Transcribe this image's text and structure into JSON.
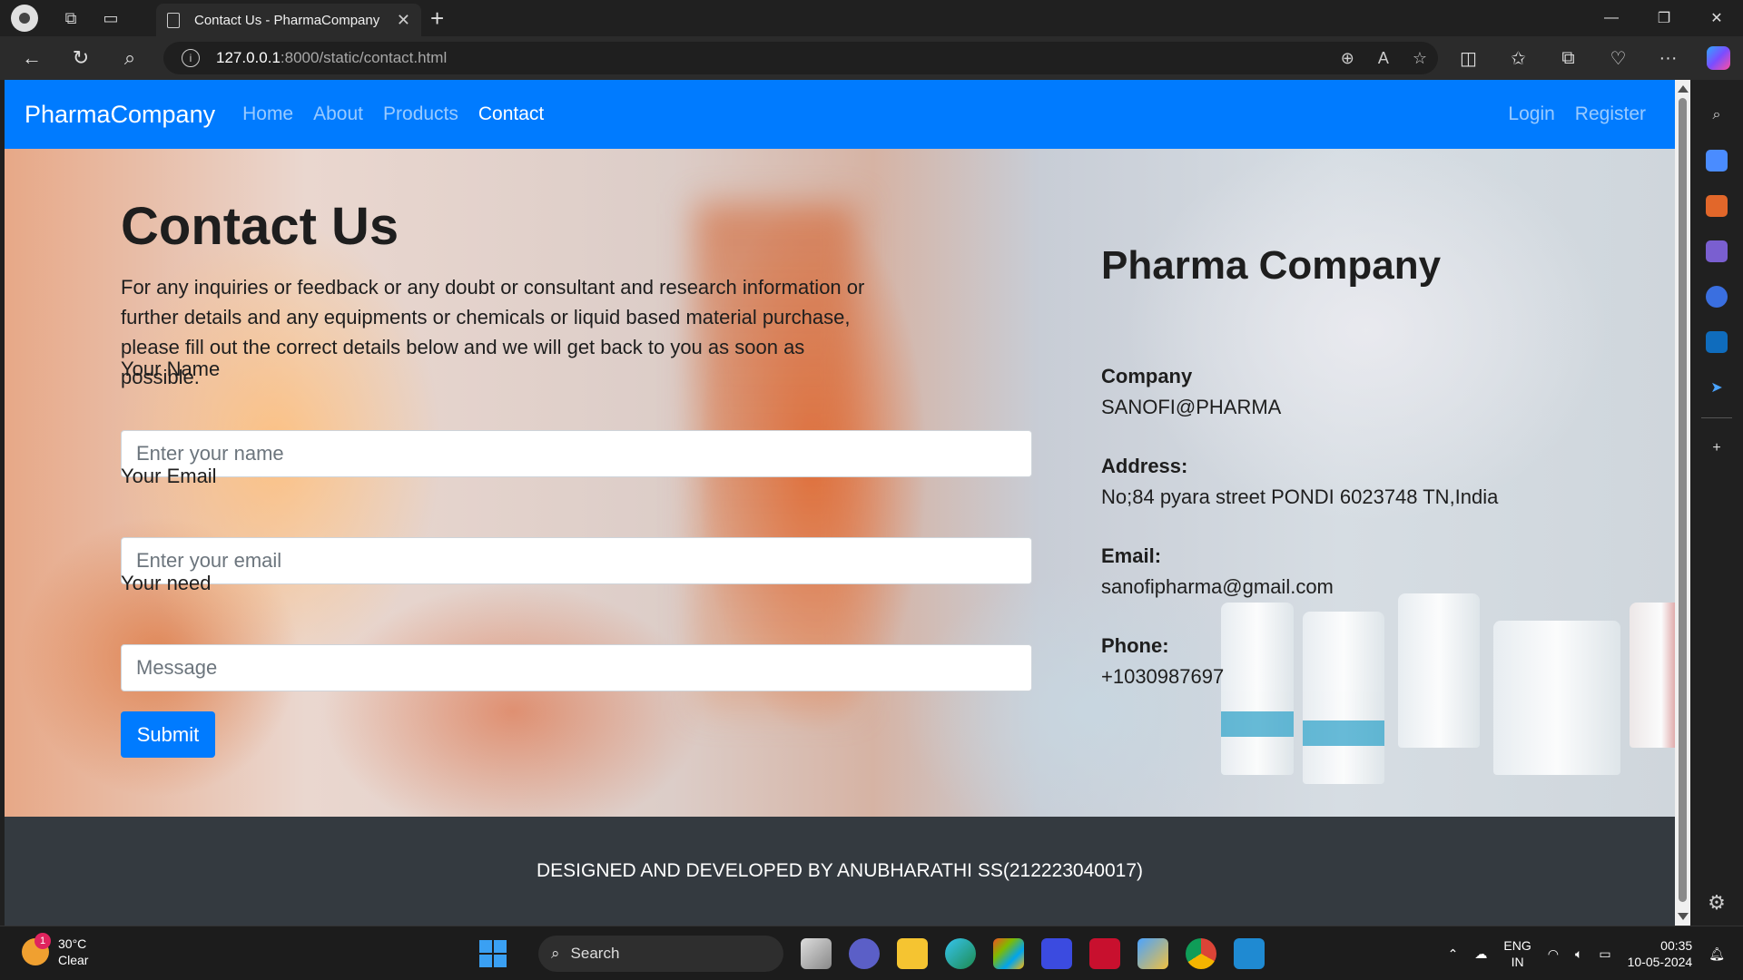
{
  "browser": {
    "tab_title": "Contact Us - PharmaCompany",
    "url_host": "127.0.0.1",
    "url_path": ":8000/static/contact.html"
  },
  "nav": {
    "brand": "PharmaCompany",
    "links": [
      "Home",
      "About",
      "Products",
      "Contact"
    ],
    "active": "Contact",
    "login": "Login",
    "register": "Register"
  },
  "contact": {
    "title": "Contact Us",
    "description": "For any inquiries or feedback or any doubt or consultant and research information or further details and any equipments or chemicals or liquid based material purchase, please fill out the correct details below and we will get back to you as soon as possible.",
    "name_label": "Your Name",
    "name_placeholder": "Enter your name",
    "email_label": "Your Email",
    "email_placeholder": "Enter your email",
    "need_label": "Your need",
    "need_placeholder": "Message",
    "submit_label": "Submit"
  },
  "info": {
    "title": "Pharma Company",
    "company_label": "Company",
    "company_value": "SANOFI@PHARMA",
    "address_label": "Address:",
    "address_value": "No;84 pyara street PONDI 6023748 TN,India",
    "email_label": "Email:",
    "email_value": "sanofipharma@gmail.com",
    "phone_label": "Phone:",
    "phone_value": "+1030987697"
  },
  "footer": {
    "text": "DESIGNED AND DEVELOPED BY ANUBHARATHI SS(212223040017)"
  },
  "taskbar": {
    "weather_badge": "1",
    "temperature": "30°C",
    "condition": "Clear",
    "search_label": "Search",
    "lang_top": "ENG",
    "lang_bottom": "IN",
    "time": "00:35",
    "date": "10-05-2024"
  },
  "colors": {
    "primary": "#007bff",
    "footer_bg": "#343a40"
  }
}
